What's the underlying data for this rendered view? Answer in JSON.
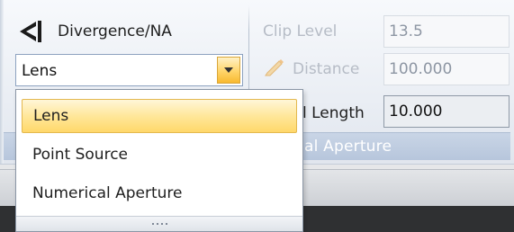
{
  "ribbon": {
    "title": "Divergence/NA",
    "title_icon": "divergence-icon",
    "combo": {
      "value": "Lens"
    },
    "clip_level": {
      "label": "Clip Level",
      "value": "13.5"
    },
    "distance": {
      "label": "Distance",
      "value": "100.000",
      "icon": "pencil-icon"
    },
    "focal_length": {
      "label": "l Length",
      "value": "10.000"
    },
    "group_label": "al Aperture"
  },
  "dropdown": {
    "items": [
      {
        "label": "Lens",
        "selected": true
      },
      {
        "label": "Point Source",
        "selected": false
      },
      {
        "label": "Numerical Aperture",
        "selected": false
      }
    ]
  },
  "colors": {
    "hover_highlight": "#ffe79a",
    "combo_button": "#ffd56a",
    "group_footer": "#c3d0e3"
  }
}
